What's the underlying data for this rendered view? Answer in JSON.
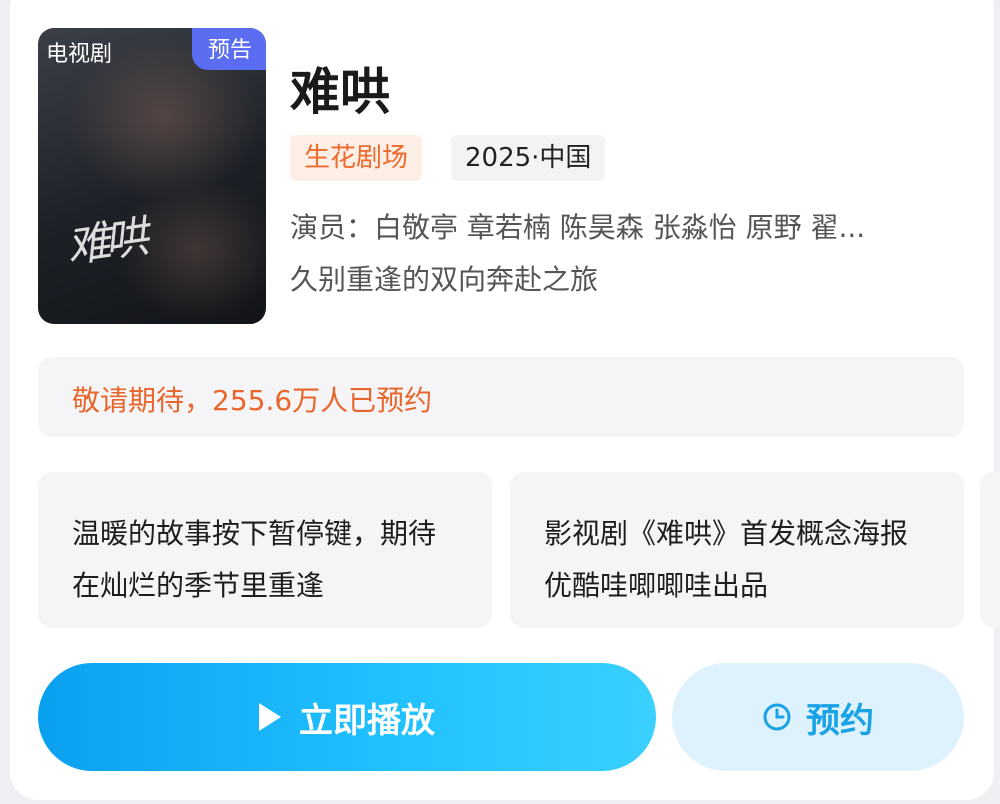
{
  "poster": {
    "type_tag": "电视剧",
    "preview_tag": "预告",
    "art_text": "难哄"
  },
  "show": {
    "title": "难哄",
    "theater": "生花剧场",
    "year_region": "2025·中国",
    "cast": "演员：白敬亭 章若楠 陈昊森  张淼怡 原野 翟...",
    "slogan": "久别重逢的双向奔赴之旅"
  },
  "notice": {
    "text": "敬请期待，255.6万人已预约"
  },
  "info_cards": [
    {
      "text": "温暖的故事按下暂停键，期待在灿烂的季节里重逢"
    },
    {
      "text": "影视剧《难哄》首发概念海报 优酷哇唧唧哇出品"
    }
  ],
  "actions": {
    "play_label": "立即播放",
    "reserve_label": "预约"
  },
  "colors": {
    "accent_orange": "#ee6a2d",
    "accent_blue": "#1aa2e6",
    "preview_tag_bg": "#5b6ef2"
  },
  "icons": [
    "play-icon",
    "clock-icon"
  ]
}
